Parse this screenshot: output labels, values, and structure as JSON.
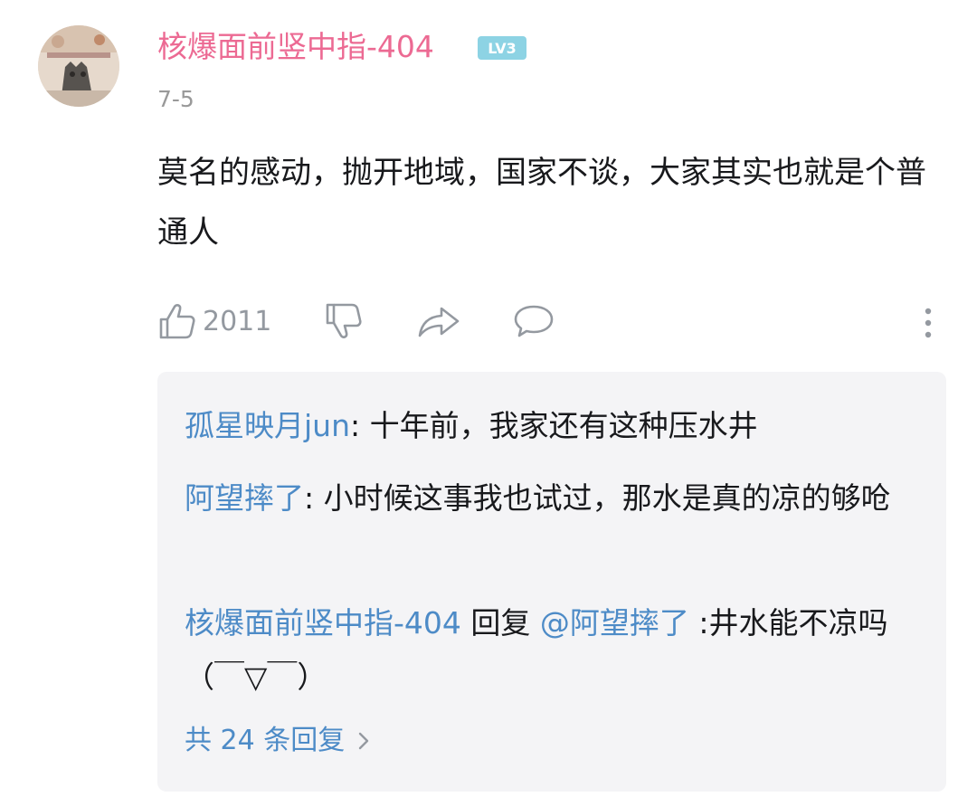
{
  "comment": {
    "username": "核爆面前竖中指-404",
    "level_badge": "LV3",
    "date": "7-5",
    "text": "莫名的感动，抛开地域，国家不谈，大家其实也就是个普通人",
    "like_count": "2011"
  },
  "icons": {
    "like": "thumbs-up-icon",
    "dislike": "thumbs-down-icon",
    "share": "share-icon",
    "reply": "comment-bubble-icon",
    "more": "more-vertical-icon",
    "expand": "chevron-right-icon"
  },
  "colors": {
    "username": "#ec6a93",
    "link": "#4d8bc7",
    "badge": "#8dd3e4",
    "text": "#18191c",
    "muted": "#9499a0",
    "reply_bg": "#f4f4f6"
  },
  "replies": [
    {
      "name": "孤星映月jun",
      "separator": ":",
      "text": " 十年前，我家还有这种压水井"
    },
    {
      "name": "阿望摔了",
      "separator": ":",
      "text": " 小时候这事我也试过，那水是真的凉的够呛"
    },
    {
      "name": "核爆面前竖中指-404",
      "reply_word": " 回复 ",
      "mention": "@阿望摔了",
      "text": " :井水能不凉吗（￣▽￣）"
    }
  ],
  "more_replies_label": "共 24 条回复"
}
